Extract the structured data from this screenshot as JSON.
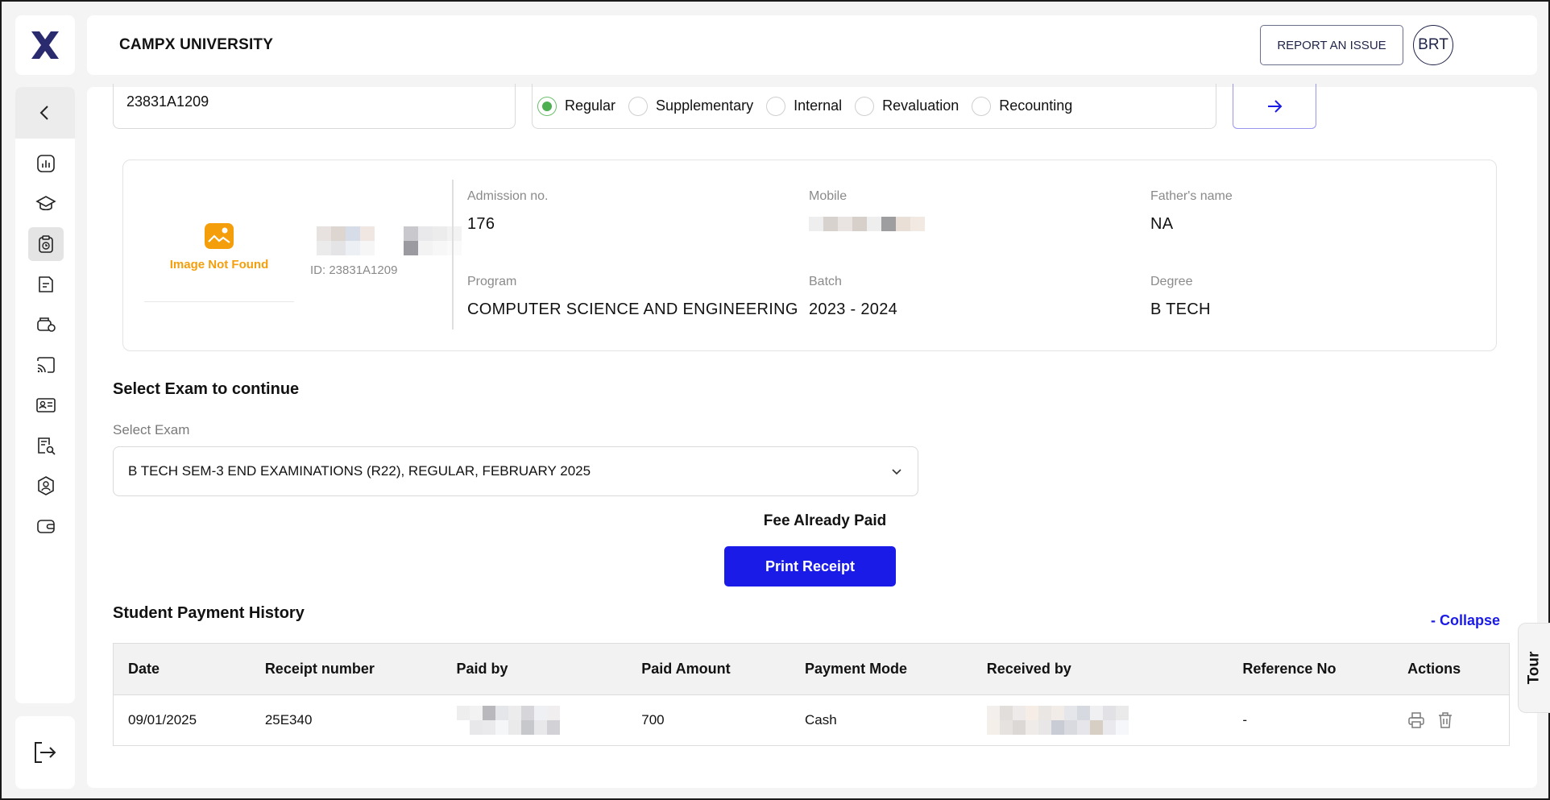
{
  "header": {
    "title": "CAMPX UNIVERSITY",
    "report_label": "REPORT AN ISSUE",
    "avatar_initials": "BRT"
  },
  "sidebar": {
    "icons": [
      "chevron-left-icon",
      "dashboard-icon",
      "graduation-cap-icon",
      "exam-clipboard-icon",
      "document-icon",
      "fee-transport-icon",
      "cast-icon",
      "id-card-icon",
      "result-search-icon",
      "admin-shield-icon",
      "wallet-icon"
    ],
    "active_index": 3,
    "logout_icon": "logout-icon"
  },
  "search": {
    "student_id": "23831A1209",
    "exam_types": [
      {
        "label": "Regular",
        "checked": true
      },
      {
        "label": "Supplementary",
        "checked": false
      },
      {
        "label": "Internal",
        "checked": false
      },
      {
        "label": "Revaluation",
        "checked": false
      },
      {
        "label": "Recounting",
        "checked": false
      }
    ]
  },
  "student": {
    "image_placeholder": "Image Not Found",
    "id_text": "ID: 23831A1209",
    "fields": {
      "admission_label": "Admission no.",
      "admission_value": "176",
      "mobile_label": "Mobile",
      "father_label": "Father's name",
      "father_value": "NA",
      "program_label": "Program",
      "program_value": "COMPUTER SCIENCE AND ENGINEERING",
      "batch_label": "Batch",
      "batch_value": "2023 - 2024",
      "degree_label": "Degree",
      "degree_value": "B TECH"
    }
  },
  "exam_select": {
    "heading": "Select Exam to continue",
    "label": "Select Exam",
    "selected": "B TECH SEM-3 END EXAMINATIONS (R22), REGULAR, FEBRUARY 2025"
  },
  "fee": {
    "status": "Fee Already Paid",
    "print_label": "Print Receipt"
  },
  "history": {
    "heading": "Student Payment History",
    "collapse_label": "- Collapse",
    "columns": [
      "Date",
      "Receipt number",
      "Paid by",
      "Paid Amount",
      "Payment Mode",
      "Received by",
      "Reference No",
      "Actions"
    ],
    "rows": [
      {
        "date": "09/01/2025",
        "receipt": "25E340",
        "amount": "700",
        "mode": "Cash",
        "reference": "-"
      }
    ]
  },
  "tour_label": "Tour",
  "colors": {
    "accent": "#1b1be8",
    "brand_navy": "#2a2a6e",
    "warning_orange": "#f59e0b",
    "radio_green": "#4caf50"
  }
}
